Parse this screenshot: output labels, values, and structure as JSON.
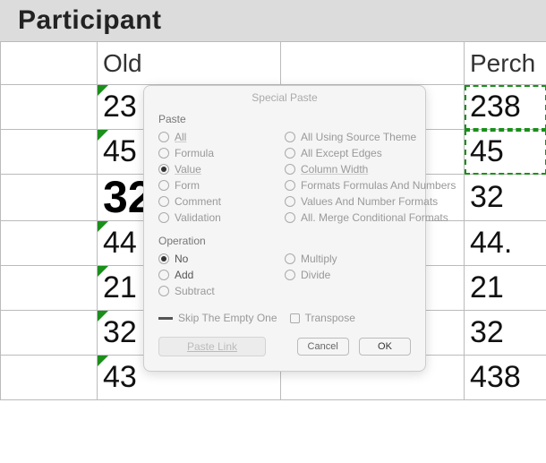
{
  "header": {
    "title": "Participant"
  },
  "columns": {
    "b": "Old",
    "d": "Perch"
  },
  "rows": [
    {
      "b": "23",
      "d": "238",
      "tri": true,
      "sel_d": true,
      "big": false
    },
    {
      "b": "45",
      "d": "45",
      "tri": true,
      "sel_d": true,
      "big": false
    },
    {
      "b": "32",
      "d": "32",
      "tri": false,
      "sel_d": false,
      "big": true
    },
    {
      "b": "44",
      "d": "44.",
      "tri": true,
      "sel_d": false,
      "big": false
    },
    {
      "b": "21",
      "d": "21",
      "tri": true,
      "sel_d": false,
      "big": false
    },
    {
      "b": "32",
      "d": "32",
      "tri": true,
      "sel_d": false,
      "big": false
    },
    {
      "b": "43",
      "d": "438",
      "tri": true,
      "sel_d": false,
      "big": false
    }
  ],
  "dialog": {
    "title": "Special Paste",
    "paste": {
      "label": "Paste",
      "left": [
        {
          "label": "All",
          "checked": false,
          "underline": true
        },
        {
          "label": "Formula",
          "checked": false
        },
        {
          "label": "Value",
          "checked": true,
          "underline": true
        },
        {
          "label": "Form",
          "checked": false
        },
        {
          "label": "Comment",
          "checked": false
        },
        {
          "label": "Validation",
          "checked": false
        }
      ],
      "right": [
        {
          "label": "All Using Source Theme",
          "checked": false
        },
        {
          "label": "All Except Edges",
          "checked": false
        },
        {
          "label": "Column Width",
          "checked": false,
          "underline": true
        },
        {
          "label": "Formats Formulas And Numbers",
          "checked": false
        },
        {
          "label": "Values And Number Formats",
          "checked": false
        },
        {
          "label": "All. Merge Conditional Formats",
          "checked": false
        }
      ]
    },
    "operation": {
      "label": "Operation",
      "left": [
        {
          "label": "No",
          "checked": true,
          "dark": true
        },
        {
          "label": "Add",
          "checked": false,
          "dark": true
        },
        {
          "label": "Subtract",
          "checked": false
        }
      ],
      "right": [
        {
          "label": "Multiply",
          "checked": false
        },
        {
          "label": "Divide",
          "checked": false
        }
      ]
    },
    "skip": "Skip The Empty One",
    "transpose": "Transpose",
    "paste_link": "Paste Link",
    "cancel": "Cancel",
    "ok": "OK"
  },
  "chart_data": {
    "type": "table",
    "title": "Participant",
    "columns": [
      "Old",
      "Perch"
    ],
    "values": [
      [
        23,
        238
      ],
      [
        45,
        45
      ],
      [
        32,
        32
      ],
      [
        44,
        44
      ],
      [
        21,
        21
      ],
      [
        32,
        32
      ],
      [
        43,
        438
      ]
    ]
  }
}
